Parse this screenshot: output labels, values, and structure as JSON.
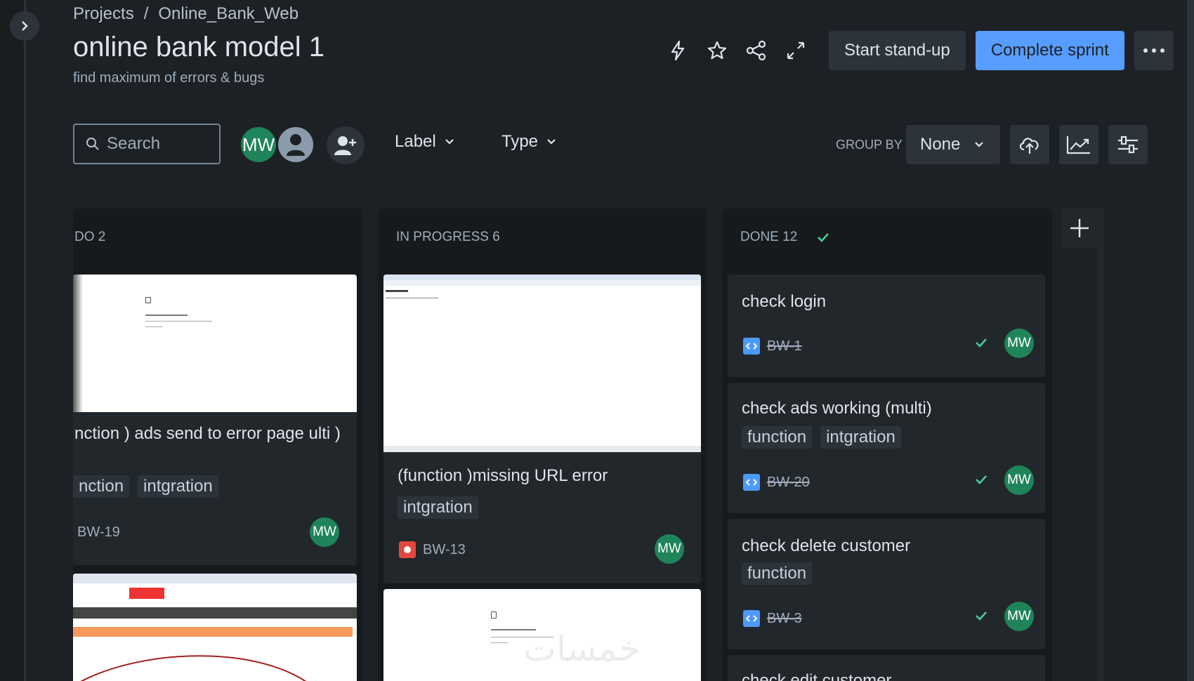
{
  "breadcrumb": {
    "projects": "Projects",
    "separator": "/",
    "project": "Online_Bank_Web"
  },
  "header": {
    "title": "online bank model 1",
    "subtitle": "find maximum of errors & bugs",
    "standup_label": "Start stand-up",
    "complete_label": "Complete sprint",
    "icons": [
      "lightning-icon",
      "star-icon",
      "share-icon",
      "expand-icon",
      "more-icon"
    ]
  },
  "toolbar": {
    "search_placeholder": "Search",
    "avatar_initials": "MW",
    "label_filter": "Label",
    "type_filter": "Type",
    "group_by_label": "GROUP BY",
    "group_by_value": "None"
  },
  "columns": {
    "todo": {
      "header": "DO 2",
      "card1": {
        "title": "nction ) ads send to error page ulti )",
        "labels": [
          "nction",
          "intgration"
        ],
        "key": "BW-19",
        "assignee": "MW"
      }
    },
    "progress": {
      "header": "IN PROGRESS 6",
      "card1": {
        "title": "(function )missing URL error",
        "labels": [
          "intgration"
        ],
        "key": "BW-13",
        "assignee": "MW"
      }
    },
    "done": {
      "header": "DONE 12",
      "card1": {
        "title": "check login",
        "key": "BW-1",
        "assignee": "MW"
      },
      "card2": {
        "title": "check ads working (multi)",
        "labels": [
          "function",
          "intgration"
        ],
        "key": "BW-20",
        "assignee": "MW"
      },
      "card3": {
        "title": "check delete customer",
        "labels": [
          "function"
        ],
        "key": "BW-3",
        "assignee": "MW"
      },
      "card4": {
        "title": "check edit customer"
      }
    }
  },
  "watermark": "خمسات",
  "colors": {
    "primary": "#579dff",
    "avatar_green": "#1f845a",
    "done_check": "#4bce97",
    "bug_red": "#e2483d",
    "task_blue": "#4c9aff"
  }
}
